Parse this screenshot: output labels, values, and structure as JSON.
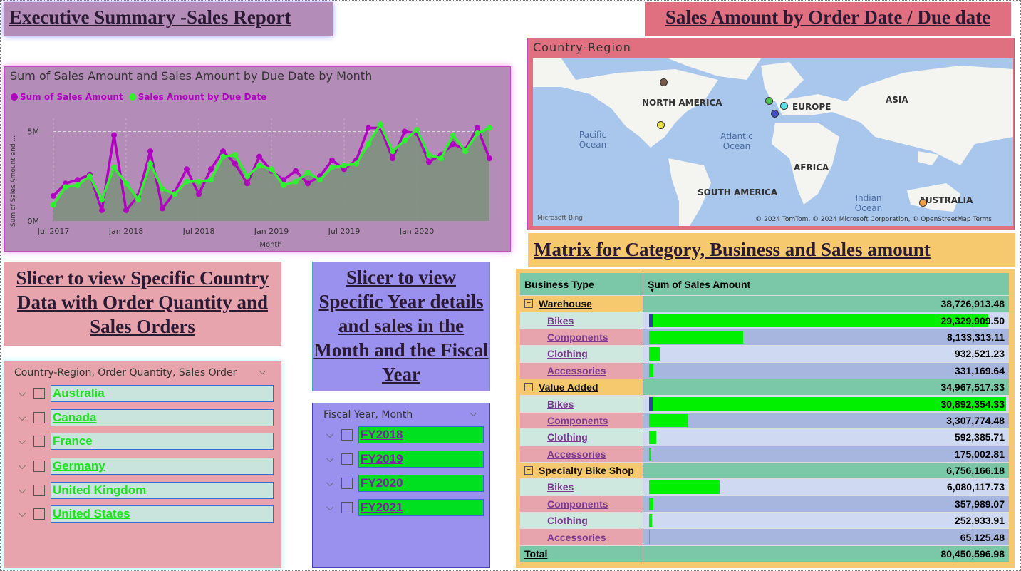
{
  "titles": {
    "executive": "Executive Summary -Sales Report",
    "sales_by_date": "Sales Amount by Order Date / Due date",
    "matrix": "Matrix for Category, Business and Sales amount",
    "slicer_country": "Slicer to view Specific Country Data with Order Quantity and Sales Orders",
    "slicer_year": "Slicer to view Specific Year details and sales in the Month and the Fiscal Year"
  },
  "chart": {
    "title": "Sum of Sales Amount and Sales Amount by Due Date by Month",
    "xlabel": "Month",
    "ylabel": "Sum of Sales Amount and ...",
    "y_ticks": [
      "0M",
      "5M"
    ],
    "x_ticks": [
      "Jul 2017",
      "Jan 2018",
      "Jul 2018",
      "Jan 2019",
      "Jul 2019",
      "Jan 2020"
    ],
    "legend": [
      "Sum of Sales Amount",
      "Sales Amount by Due Date"
    ],
    "colors": {
      "series1": "#b000c0",
      "series2": "#30f030",
      "area": "#7f9080"
    }
  },
  "chart_data": {
    "type": "line",
    "title": "Sum of Sales Amount and Sales Amount by Due Date by Month",
    "xlabel": "Month",
    "ylabel": "Sum of Sales Amount and ...",
    "ylim": [
      0,
      5.5
    ],
    "x": [
      "2017-07",
      "2017-08",
      "2017-09",
      "2017-10",
      "2017-11",
      "2017-12",
      "2018-01",
      "2018-02",
      "2018-03",
      "2018-04",
      "2018-05",
      "2018-06",
      "2018-07",
      "2018-08",
      "2018-09",
      "2018-10",
      "2018-11",
      "2018-12",
      "2019-01",
      "2019-02",
      "2019-03",
      "2019-04",
      "2019-05",
      "2019-06",
      "2019-07",
      "2019-08",
      "2019-09",
      "2019-10",
      "2019-11",
      "2019-12",
      "2020-01",
      "2020-02",
      "2020-03",
      "2020-04",
      "2020-05",
      "2020-06"
    ],
    "series": [
      {
        "name": "Sum of Sales Amount",
        "values": [
          1.4,
          2.1,
          2.3,
          2.6,
          0.6,
          4.8,
          0.6,
          1.4,
          3.9,
          0.7,
          1.6,
          2.9,
          1.5,
          2.9,
          3.9,
          3.2,
          2.1,
          3.6,
          2.8,
          2.3,
          2.8,
          2.1,
          2.5,
          3.4,
          2.9,
          3.4,
          5.2,
          5.2,
          3.5,
          5.0,
          4.9,
          3.3,
          3.7,
          4.3,
          4.0,
          5.2,
          3.5
        ]
      },
      {
        "name": "Sales Amount by Due Date",
        "values": [
          0.9,
          1.9,
          2.0,
          2.5,
          1.2,
          3.0,
          2.1,
          1.2,
          3.2,
          1.8,
          1.5,
          2.2,
          2.2,
          2.3,
          3.6,
          3.7,
          2.5,
          3.1,
          2.9,
          2.0,
          2.2,
          2.7,
          2.3,
          3.0,
          3.1,
          3.2,
          4.3,
          5.4,
          3.9,
          4.5,
          5.1,
          3.7,
          3.5,
          4.8,
          3.9,
          4.9,
          5.2
        ]
      }
    ]
  },
  "map": {
    "title": "Country-Region",
    "continents": [
      "NORTH AMERICA",
      "EUROPE",
      "ASIA",
      "AFRICA",
      "SOUTH AMERICA",
      "AUSTRALIA"
    ],
    "oceans": [
      "Pacific Ocean",
      "Atlantic Ocean",
      "Indian Ocean"
    ],
    "credit": "© 2024 TomTom, © 2024 Microsoft Corporation, © OpenStreetMap  Terms",
    "brand": "Microsoft Bing"
  },
  "country_slicer": {
    "header": "Country-Region, Order Quantity, Sales Order",
    "items": [
      "Australia",
      "Canada",
      "France",
      "Germany",
      "United Kingdom",
      "United States"
    ]
  },
  "year_slicer": {
    "header": "Fiscal Year, Month",
    "items": [
      "FY2018",
      "FY2019",
      "FY2020",
      "FY2021"
    ]
  },
  "matrix": {
    "col1": "Business Type",
    "col2": "Sum of Sales Amount",
    "rows": [
      {
        "kind": "group",
        "label": "Warehouse",
        "value": "38,726,913.48"
      },
      {
        "kind": "sub",
        "label": "Bikes",
        "value": "29,329,909.50",
        "pct": 0.95
      },
      {
        "kind": "sub",
        "label": "Components",
        "value": "8,133,313.11",
        "pct": 0.263
      },
      {
        "kind": "sub",
        "label": "Clothing",
        "value": "932,521.23",
        "pct": 0.03
      },
      {
        "kind": "sub",
        "label": "Accessories",
        "value": "331,169.64",
        "pct": 0.011
      },
      {
        "kind": "group",
        "label": "Value Added",
        "value": "34,967,517.33"
      },
      {
        "kind": "sub",
        "label": "Bikes",
        "value": "30,892,354.33",
        "pct": 1.0
      },
      {
        "kind": "sub",
        "label": "Components",
        "value": "3,307,774.48",
        "pct": 0.107
      },
      {
        "kind": "sub",
        "label": "Clothing",
        "value": "592,385.71",
        "pct": 0.019
      },
      {
        "kind": "sub",
        "label": "Accessories",
        "value": "175,002.81",
        "pct": 0.006
      },
      {
        "kind": "group",
        "label": "Specialty Bike Shop",
        "value": "6,756,166.18"
      },
      {
        "kind": "sub",
        "label": "Bikes",
        "value": "6,080,117.73",
        "pct": 0.197
      },
      {
        "kind": "sub",
        "label": "Components",
        "value": "357,989.07",
        "pct": 0.012
      },
      {
        "kind": "sub",
        "label": "Clothing",
        "value": "252,933.91",
        "pct": 0.008
      },
      {
        "kind": "sub",
        "label": "Accessories",
        "value": "65,125.48",
        "pct": 0.002
      },
      {
        "kind": "total",
        "label": "Total",
        "value": "80,450,596.98"
      }
    ]
  }
}
